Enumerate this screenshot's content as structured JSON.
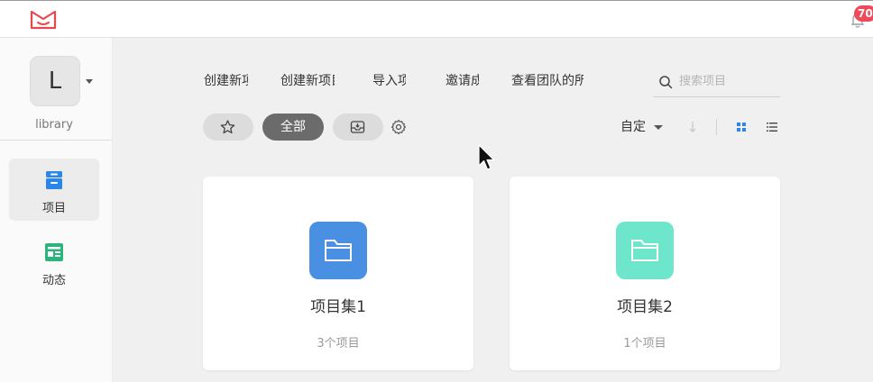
{
  "topbar": {
    "notification_count": "70",
    "colors": {
      "logo": "#e8474f",
      "badge": "#f04a5a"
    }
  },
  "sidebar": {
    "avatar_letter": "L",
    "team_name": "library",
    "items": [
      {
        "label": "项目",
        "icon": "project-icon",
        "active": true,
        "color": "#2a86e8"
      },
      {
        "label": "动态",
        "icon": "activity-icon",
        "active": false,
        "color": "#2bb57d"
      }
    ]
  },
  "toolbar": {
    "tabs": [
      "创建新项目集",
      "创建新项目",
      "导入项目",
      "邀请成员",
      "查看团队的所有项目"
    ],
    "search_placeholder": "搜索项目",
    "filters": {
      "all_label": "全部"
    },
    "sort_label": "自定"
  },
  "projects": [
    {
      "title": "项目集1",
      "count": "3个项目",
      "color": "#4a90e2"
    },
    {
      "title": "项目集2",
      "count": "1个项目",
      "color": "#6ee6cc"
    }
  ]
}
